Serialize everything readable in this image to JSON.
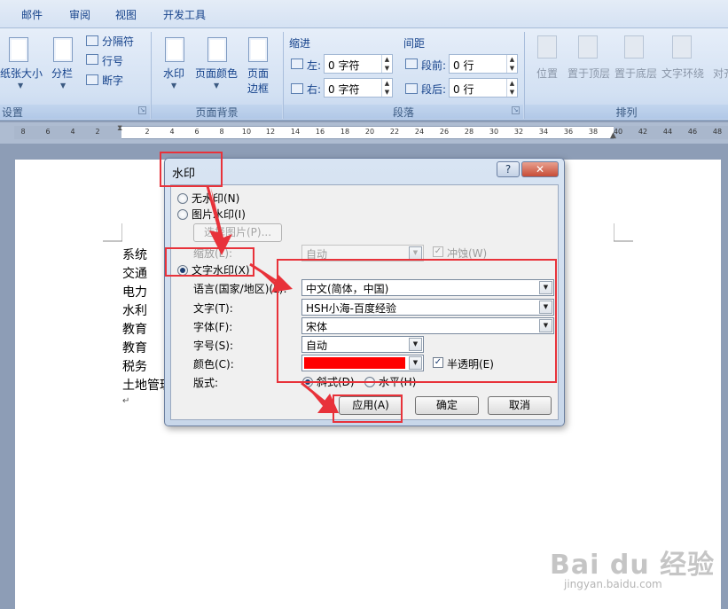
{
  "tabs": [
    "邮件",
    "审阅",
    "视图",
    "开发工具"
  ],
  "ribbon": {
    "setup": {
      "paper_size": "纸张大小",
      "columns": "分栏",
      "breaks": "分隔符",
      "line_numbers": "行号",
      "hyphenation": "断字",
      "group_label": "设置"
    },
    "background": {
      "watermark": "水印",
      "page_color": "页面颜色",
      "page_border_1": "页面",
      "page_border_2": "边框",
      "group_label": "页面背景"
    },
    "paragraph": {
      "indent_header": "缩进",
      "spacing_header": "间距",
      "left_label": "左:",
      "left_value": "0 字符",
      "right_label": "右:",
      "right_value": "0 字符",
      "before_label": "段前:",
      "before_value": "0 行",
      "after_label": "段后:",
      "after_value": "0 行",
      "group_label": "段落"
    },
    "arrange": {
      "position": "位置",
      "bring_front": "置于顶层",
      "send_back": "置于底层",
      "text_wrap": "文字环绕",
      "align": "对齐",
      "group_label": "排列"
    }
  },
  "ruler_ticks": [
    "8",
    "6",
    "4",
    "2",
    "2",
    "4",
    "6",
    "8",
    "10",
    "12",
    "14",
    "16",
    "18",
    "20",
    "22",
    "24",
    "26",
    "28",
    "30",
    "32",
    "34",
    "36",
    "38",
    "40",
    "42",
    "44",
    "46",
    "48"
  ],
  "document_lines": [
    "系统",
    "交通",
    "电力",
    "水利",
    "教育",
    "教育",
    "税务",
    "土地管理"
  ],
  "dialog": {
    "title": "水印",
    "help_button": "?",
    "close_button": "✕",
    "no_watermark": "无水印(N)",
    "picture_watermark": "图片水印(I)",
    "select_picture": "选择图片(P)...",
    "scale_label": "缩放(L):",
    "scale_value": "自动",
    "washout_label": "冲蚀(W)",
    "text_watermark": "文字水印(X)",
    "language_label": "语言(国家/地区)(L):",
    "language_value": "中文(简体，中国)",
    "text_label": "文字(T):",
    "text_value": "HSH小海-百度经验",
    "font_label": "字体(F):",
    "font_value": "宋体",
    "size_label": "字号(S):",
    "size_value": "自动",
    "color_label": "颜色(C):",
    "color_value": "#ff0000",
    "semitransparent_label": "半透明(E)",
    "layout_label": "版式:",
    "diagonal_label": "斜式(D)",
    "horizontal_label": "水平(H)",
    "apply_button": "应用(A)",
    "ok_button": "确定",
    "cancel_button": "取消"
  },
  "watermark": {
    "logo": "Bai du 经验",
    "url": "jingyan.baidu.com"
  },
  "colors": {
    "annotation": "#e8323a",
    "ribbon_text": "#15428b"
  }
}
